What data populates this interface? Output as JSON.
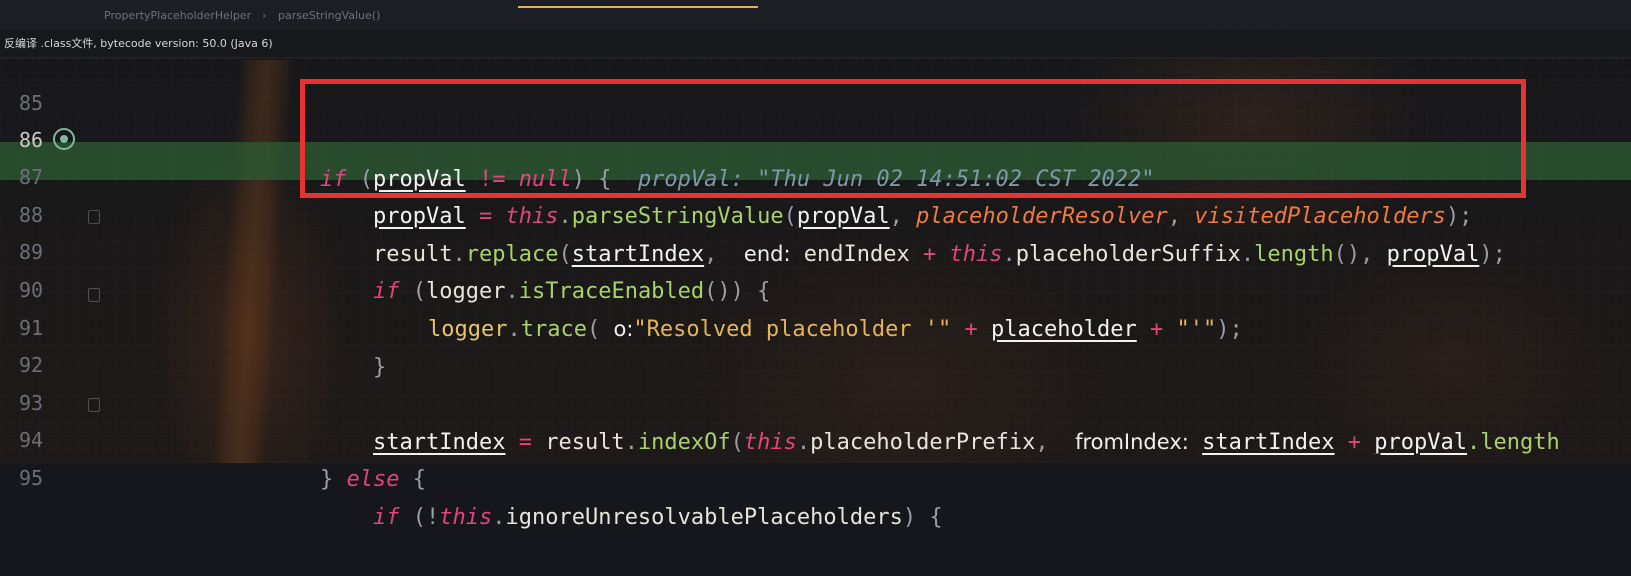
{
  "tabs": {
    "class_name": "PropertyPlaceholderHelper",
    "method_name": "parseStringValue()"
  },
  "notice": "反编译 .class文件, bytecode version: 50.0 (Java 6)",
  "lines": {
    "l85": {
      "num": "85"
    },
    "l86": {
      "num": "86",
      "kw_if": "if",
      "open": " (",
      "v": "propVal",
      "op": " != ",
      "null": "null",
      "close": ") {",
      "inline": "propVal: \"Thu Jun 02 14:51:02 CST 2022\""
    },
    "l87": {
      "num": "87",
      "v": "propVal",
      "eq": " = ",
      "this": "this",
      "dot": ".",
      "m": "parseStringValue",
      "p1": "propVal",
      "comma": ", ",
      "p2": "placeholderResolver",
      "p3": "visitedPlaceholders",
      "end": ");"
    },
    "l88": {
      "num": "88",
      "r": "result",
      "dot": ".",
      "m": "replace",
      "paren": "(",
      "a1": "startIndex",
      "comma": ",",
      "hint": "end:",
      "a2": "endIndex",
      "plus": " + ",
      "this": "this",
      "f": "placeholderSuffix",
      "len": "length",
      "callend": "(), ",
      "a3": "propVal",
      "end": ");"
    },
    "l89": {
      "num": "89",
      "kw": "if",
      "open": " (",
      "o": "logger",
      "m": "isTraceEnabled",
      "end": "()) {"
    },
    "l90": {
      "num": "90",
      "o": "logger",
      "m": "trace",
      "hint": "o:",
      "s1": "\"Resolved placeholder '\"",
      "plus": " + ",
      "v": "placeholder",
      "s2": "\"'\"",
      "end": ");"
    },
    "l91": {
      "num": "91",
      "brace": "}"
    },
    "l92": {
      "num": "92"
    },
    "l93": {
      "num": "93",
      "v": "startIndex",
      "eq": " = ",
      "r": "result",
      "m": "indexOf",
      "open": "(",
      "this": "this",
      "f": "placeholderPrefix",
      "comma": ",",
      "hint": "fromIndex:",
      "a1": "startIndex",
      "plus": " + ",
      "a2": "propVal",
      "len": ".length"
    },
    "l94": {
      "num": "94",
      "brace": "} ",
      "kw": "else",
      "open": " {"
    },
    "l95": {
      "num": "95",
      "kw": "if",
      "open": " (!",
      "this": "this",
      "f": "ignoreUnresolvablePlaceholders",
      "end": ") {"
    }
  }
}
